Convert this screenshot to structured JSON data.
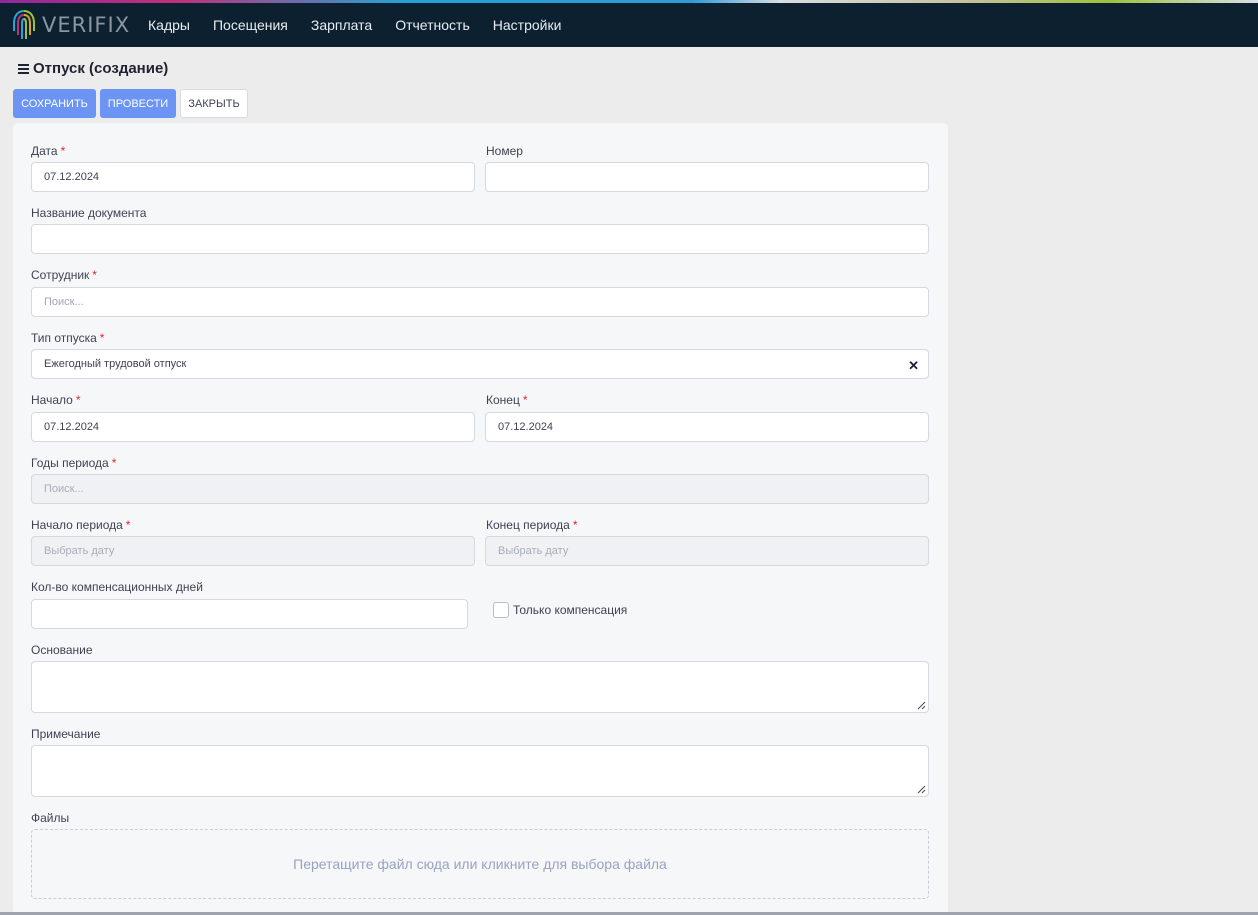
{
  "brand": {
    "name": "VERIFIX"
  },
  "nav": {
    "items": [
      "Кадры",
      "Посещения",
      "Зарплата",
      "Отчетность",
      "Настройки"
    ]
  },
  "page": {
    "title": "Отпуск (создание)"
  },
  "toolbar": {
    "save_label": "СОХРАНИТЬ",
    "post_label": "ПРОВЕСТИ",
    "close_label": "ЗАКРЫТЬ"
  },
  "form": {
    "required_mark": "*",
    "date": {
      "label": "Дата",
      "value": "07.12.2024"
    },
    "number": {
      "label": "Номер",
      "value": ""
    },
    "doc_name": {
      "label": "Название документа",
      "value": ""
    },
    "employee": {
      "label": "Сотрудник",
      "placeholder": "Поиск..."
    },
    "vacation_type": {
      "label": "Тип отпуска",
      "value": "Ежегодный трудовой отпуск"
    },
    "start": {
      "label": "Начало",
      "value": "07.12.2024"
    },
    "end": {
      "label": "Конец",
      "value": "07.12.2024"
    },
    "period_years": {
      "label": "Годы периода",
      "placeholder": "Поиск..."
    },
    "period_start": {
      "label": "Начало периода",
      "placeholder": "Выбрать дату"
    },
    "period_end": {
      "label": "Конец периода",
      "placeholder": "Выбрать дату"
    },
    "comp_days": {
      "label": "Кол-во компенсационных дней",
      "value": ""
    },
    "only_compensation": {
      "label": "Только компенсация",
      "checked": false
    },
    "basis": {
      "label": "Основание",
      "value": ""
    },
    "note": {
      "label": "Примечание",
      "value": ""
    },
    "files": {
      "label": "Файлы",
      "dropzone_text": "Перетащите файл сюда или кликните для выбора файла"
    }
  },
  "icons": {
    "menu": "menu-icon",
    "close": "close-icon",
    "logo": "fingerprint-logo-icon"
  },
  "colors": {
    "topbar": "#0c2030",
    "primary": "#6b94f5",
    "required": "#e2252b"
  }
}
